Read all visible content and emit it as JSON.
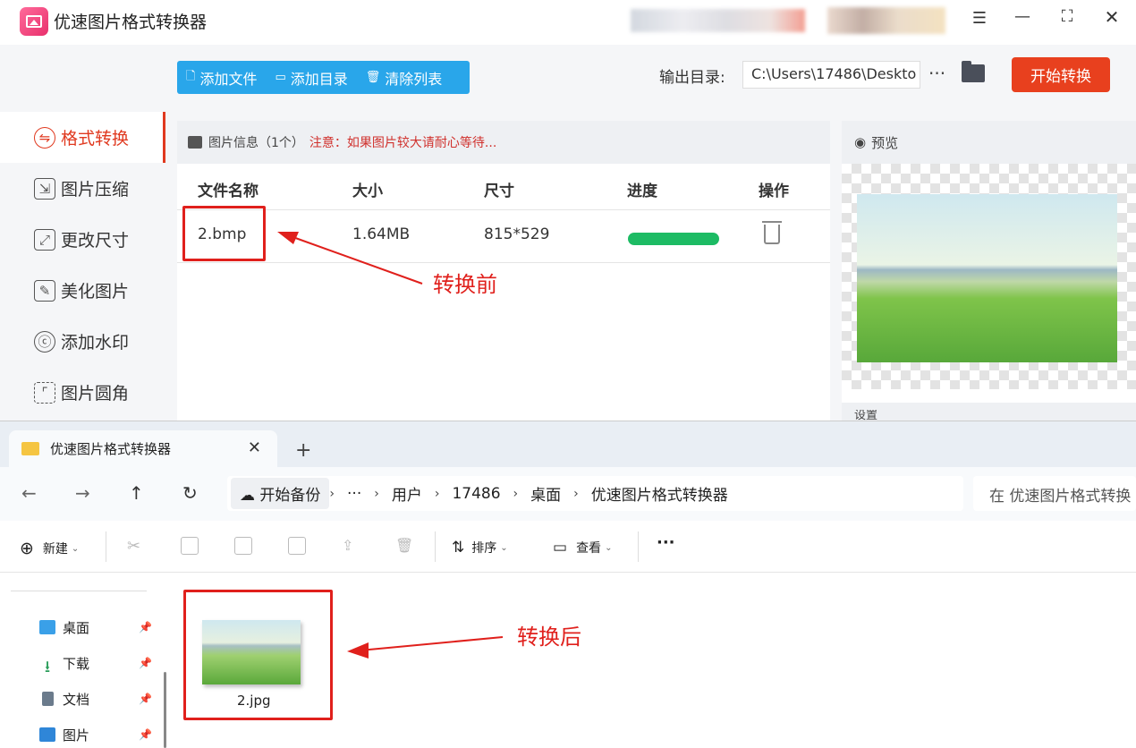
{
  "app": {
    "title": "优速图片格式转换器",
    "toolbar": {
      "add_file": "添加文件",
      "add_dir": "添加目录",
      "clear_list": "清除列表"
    },
    "output_label": "输出目录:",
    "output_path": "C:\\Users\\17486\\Deskto",
    "more": "···",
    "start_button": "开始转换",
    "sidebar": [
      {
        "label": "格式转换",
        "icon": "convert-icon",
        "active": true
      },
      {
        "label": "图片压缩",
        "icon": "compress-icon"
      },
      {
        "label": "更改尺寸",
        "icon": "resize-icon"
      },
      {
        "label": "美化图片",
        "icon": "beautify-icon"
      },
      {
        "label": "添加水印",
        "icon": "watermark-icon"
      },
      {
        "label": "图片圆角",
        "icon": "rounded-corner-icon"
      }
    ],
    "info": {
      "title": "图片信息（1个）",
      "note": "注意：如果图片较大请耐心等待..."
    },
    "table": {
      "headers": [
        "文件名称",
        "大小",
        "尺寸",
        "进度",
        "操作"
      ],
      "rows": [
        {
          "name": "2.bmp",
          "size": "1.64MB",
          "dim": "815*529",
          "progress": 1.0
        }
      ]
    },
    "preview_label": "预览",
    "settings_label": "设置",
    "annotation_before": "转换前"
  },
  "explorer": {
    "tab_title": "优速图片格式转换器",
    "breadcrumb": [
      "开始备份",
      "···",
      "用户",
      "17486",
      "桌面",
      "优速图片格式转换器"
    ],
    "search_placeholder": "在 优速图片格式转换",
    "commands": {
      "new": "新建",
      "sort": "排序",
      "view": "查看",
      "more": "···"
    },
    "nav": [
      {
        "label": "桌面",
        "color": "#3aa0e8"
      },
      {
        "label": "下载",
        "color": "#2a9d5a"
      },
      {
        "label": "文档",
        "color": "#6b7b8c"
      },
      {
        "label": "图片",
        "color": "#2f86d8"
      }
    ],
    "file": {
      "name": "2.jpg"
    },
    "annotation_after": "转换后"
  },
  "colors": {
    "accent_red": "#e8401e",
    "blue": "#29a6ea",
    "progress_green": "#1dbb64",
    "annotation_red": "#e0201c"
  }
}
